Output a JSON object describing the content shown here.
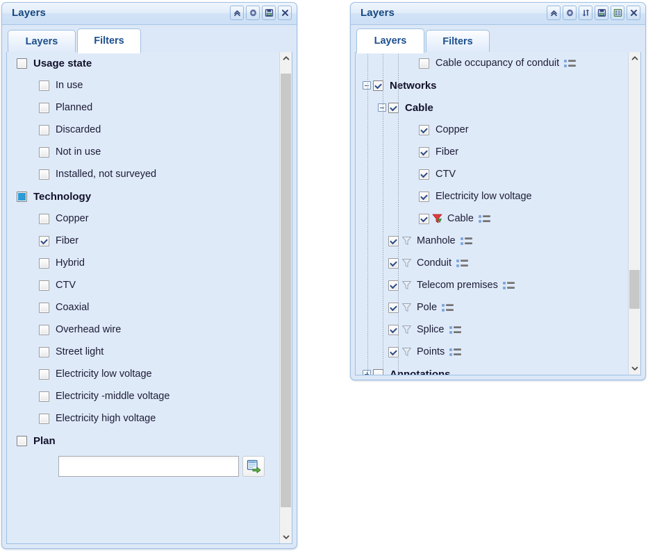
{
  "left_panel": {
    "title": "Layers",
    "titlebar_buttons": [
      {
        "name": "collapse-icon",
        "label": "Collapse"
      },
      {
        "name": "gear-icon",
        "label": "Settings"
      },
      {
        "name": "save-icon",
        "label": "Save"
      },
      {
        "name": "close-icon",
        "label": "Close"
      }
    ],
    "tabs": [
      {
        "label": "Layers",
        "active": false
      },
      {
        "label": "Filters",
        "active": true
      }
    ],
    "rows": [
      {
        "label": "Usage state",
        "level": 0,
        "bold": true,
        "check": "unchecked"
      },
      {
        "label": "In use",
        "level": 1,
        "bold": false,
        "check": "unchecked"
      },
      {
        "label": "Planned",
        "level": 1,
        "bold": false,
        "check": "unchecked"
      },
      {
        "label": "Discarded",
        "level": 1,
        "bold": false,
        "check": "unchecked"
      },
      {
        "label": "Not in use",
        "level": 1,
        "bold": false,
        "check": "unchecked"
      },
      {
        "label": "Installed, not surveyed",
        "level": 1,
        "bold": false,
        "check": "unchecked"
      },
      {
        "label": "Technology",
        "level": 0,
        "bold": true,
        "check": "partial"
      },
      {
        "label": "Copper",
        "level": 1,
        "bold": false,
        "check": "unchecked"
      },
      {
        "label": "Fiber",
        "level": 1,
        "bold": false,
        "check": "checked"
      },
      {
        "label": "Hybrid",
        "level": 1,
        "bold": false,
        "check": "unchecked"
      },
      {
        "label": "CTV",
        "level": 1,
        "bold": false,
        "check": "unchecked"
      },
      {
        "label": "Coaxial",
        "level": 1,
        "bold": false,
        "check": "unchecked"
      },
      {
        "label": "Overhead wire",
        "level": 1,
        "bold": false,
        "check": "unchecked"
      },
      {
        "label": "Street light",
        "level": 1,
        "bold": false,
        "check": "unchecked"
      },
      {
        "label": "Electricity low voltage",
        "level": 1,
        "bold": false,
        "check": "unchecked"
      },
      {
        "label": "Electricity -middle voltage",
        "level": 1,
        "bold": false,
        "check": "unchecked"
      },
      {
        "label": "Electricity high voltage",
        "level": 1,
        "bold": false,
        "check": "unchecked"
      },
      {
        "label": "Plan",
        "level": 0,
        "bold": true,
        "check": "unchecked"
      }
    ],
    "plan_input": {
      "value": "",
      "placeholder": ""
    },
    "plan_button": {
      "name": "select-plan-icon",
      "label": "Select plan"
    },
    "scrollbar": {
      "thumb_top_pct": 2,
      "thumb_height_pct": 93
    }
  },
  "right_panel": {
    "title": "Layers",
    "titlebar_buttons": [
      {
        "name": "collapse-icon",
        "label": "Collapse"
      },
      {
        "name": "gear-icon",
        "label": "Settings"
      },
      {
        "name": "refresh-icon",
        "label": "Refresh"
      },
      {
        "name": "save-icon",
        "label": "Save"
      },
      {
        "name": "legend-icon",
        "label": "Legend"
      },
      {
        "name": "close-icon",
        "label": "Close"
      }
    ],
    "tabs": [
      {
        "label": "Layers",
        "active": true
      },
      {
        "label": "Filters",
        "active": false
      }
    ],
    "rows": [
      {
        "label": "Cable occupancy of conduit",
        "level": 3,
        "bold": false,
        "check": "unchecked",
        "expander": "none",
        "funnel": "none",
        "legend": true
      },
      {
        "label": "Networks",
        "level": 0,
        "bold": true,
        "check": "checked",
        "expander": "minus",
        "funnel": "none",
        "legend": false
      },
      {
        "label": "Cable",
        "level": 1,
        "bold": true,
        "check": "checked",
        "expander": "minus",
        "funnel": "none",
        "legend": false
      },
      {
        "label": "Copper",
        "level": 3,
        "bold": false,
        "check": "checked",
        "expander": "none",
        "funnel": "none",
        "legend": false
      },
      {
        "label": "Fiber",
        "level": 3,
        "bold": false,
        "check": "checked",
        "expander": "none",
        "funnel": "none",
        "legend": false
      },
      {
        "label": "CTV",
        "level": 3,
        "bold": false,
        "check": "checked",
        "expander": "none",
        "funnel": "none",
        "legend": false
      },
      {
        "label": "Electricity low voltage",
        "level": 3,
        "bold": false,
        "check": "checked",
        "expander": "none",
        "funnel": "none",
        "legend": false
      },
      {
        "label": "Cable",
        "level": 3,
        "bold": false,
        "check": "checked",
        "expander": "none",
        "funnel": "active",
        "legend": true
      },
      {
        "label": "Manhole",
        "level": 2,
        "bold": false,
        "check": "checked",
        "expander": "none",
        "funnel": "inactive",
        "legend": true
      },
      {
        "label": "Conduit",
        "level": 2,
        "bold": false,
        "check": "checked",
        "expander": "none",
        "funnel": "inactive",
        "legend": true
      },
      {
        "label": "Telecom premises",
        "level": 2,
        "bold": false,
        "check": "checked",
        "expander": "none",
        "funnel": "inactive",
        "legend": true
      },
      {
        "label": "Pole",
        "level": 2,
        "bold": false,
        "check": "checked",
        "expander": "none",
        "funnel": "inactive",
        "legend": true
      },
      {
        "label": "Splice",
        "level": 2,
        "bold": false,
        "check": "checked",
        "expander": "none",
        "funnel": "inactive",
        "legend": true
      },
      {
        "label": "Points",
        "level": 2,
        "bold": false,
        "check": "checked",
        "expander": "none",
        "funnel": "inactive",
        "legend": true
      },
      {
        "label": "Annotations",
        "level": 0,
        "bold": true,
        "check": "unchecked",
        "expander": "plus",
        "funnel": "none",
        "legend": false
      }
    ],
    "scrollbar": {
      "thumb_top_pct": 69,
      "thumb_height_pct": 13
    }
  },
  "colors": {
    "panel_bg": "#dce8f7",
    "list_bg": "#dfeaf9",
    "border": "#9fc0e4",
    "title_text": "#16477f",
    "tab_text": "#1c4f8d",
    "accent_blue": "#2e9bd6",
    "check_mark": "#2b4a87",
    "funnel_active": "#e23b3b",
    "funnel_arrow": "#3faa3f",
    "scroll_thumb": "#c8c8c8"
  }
}
